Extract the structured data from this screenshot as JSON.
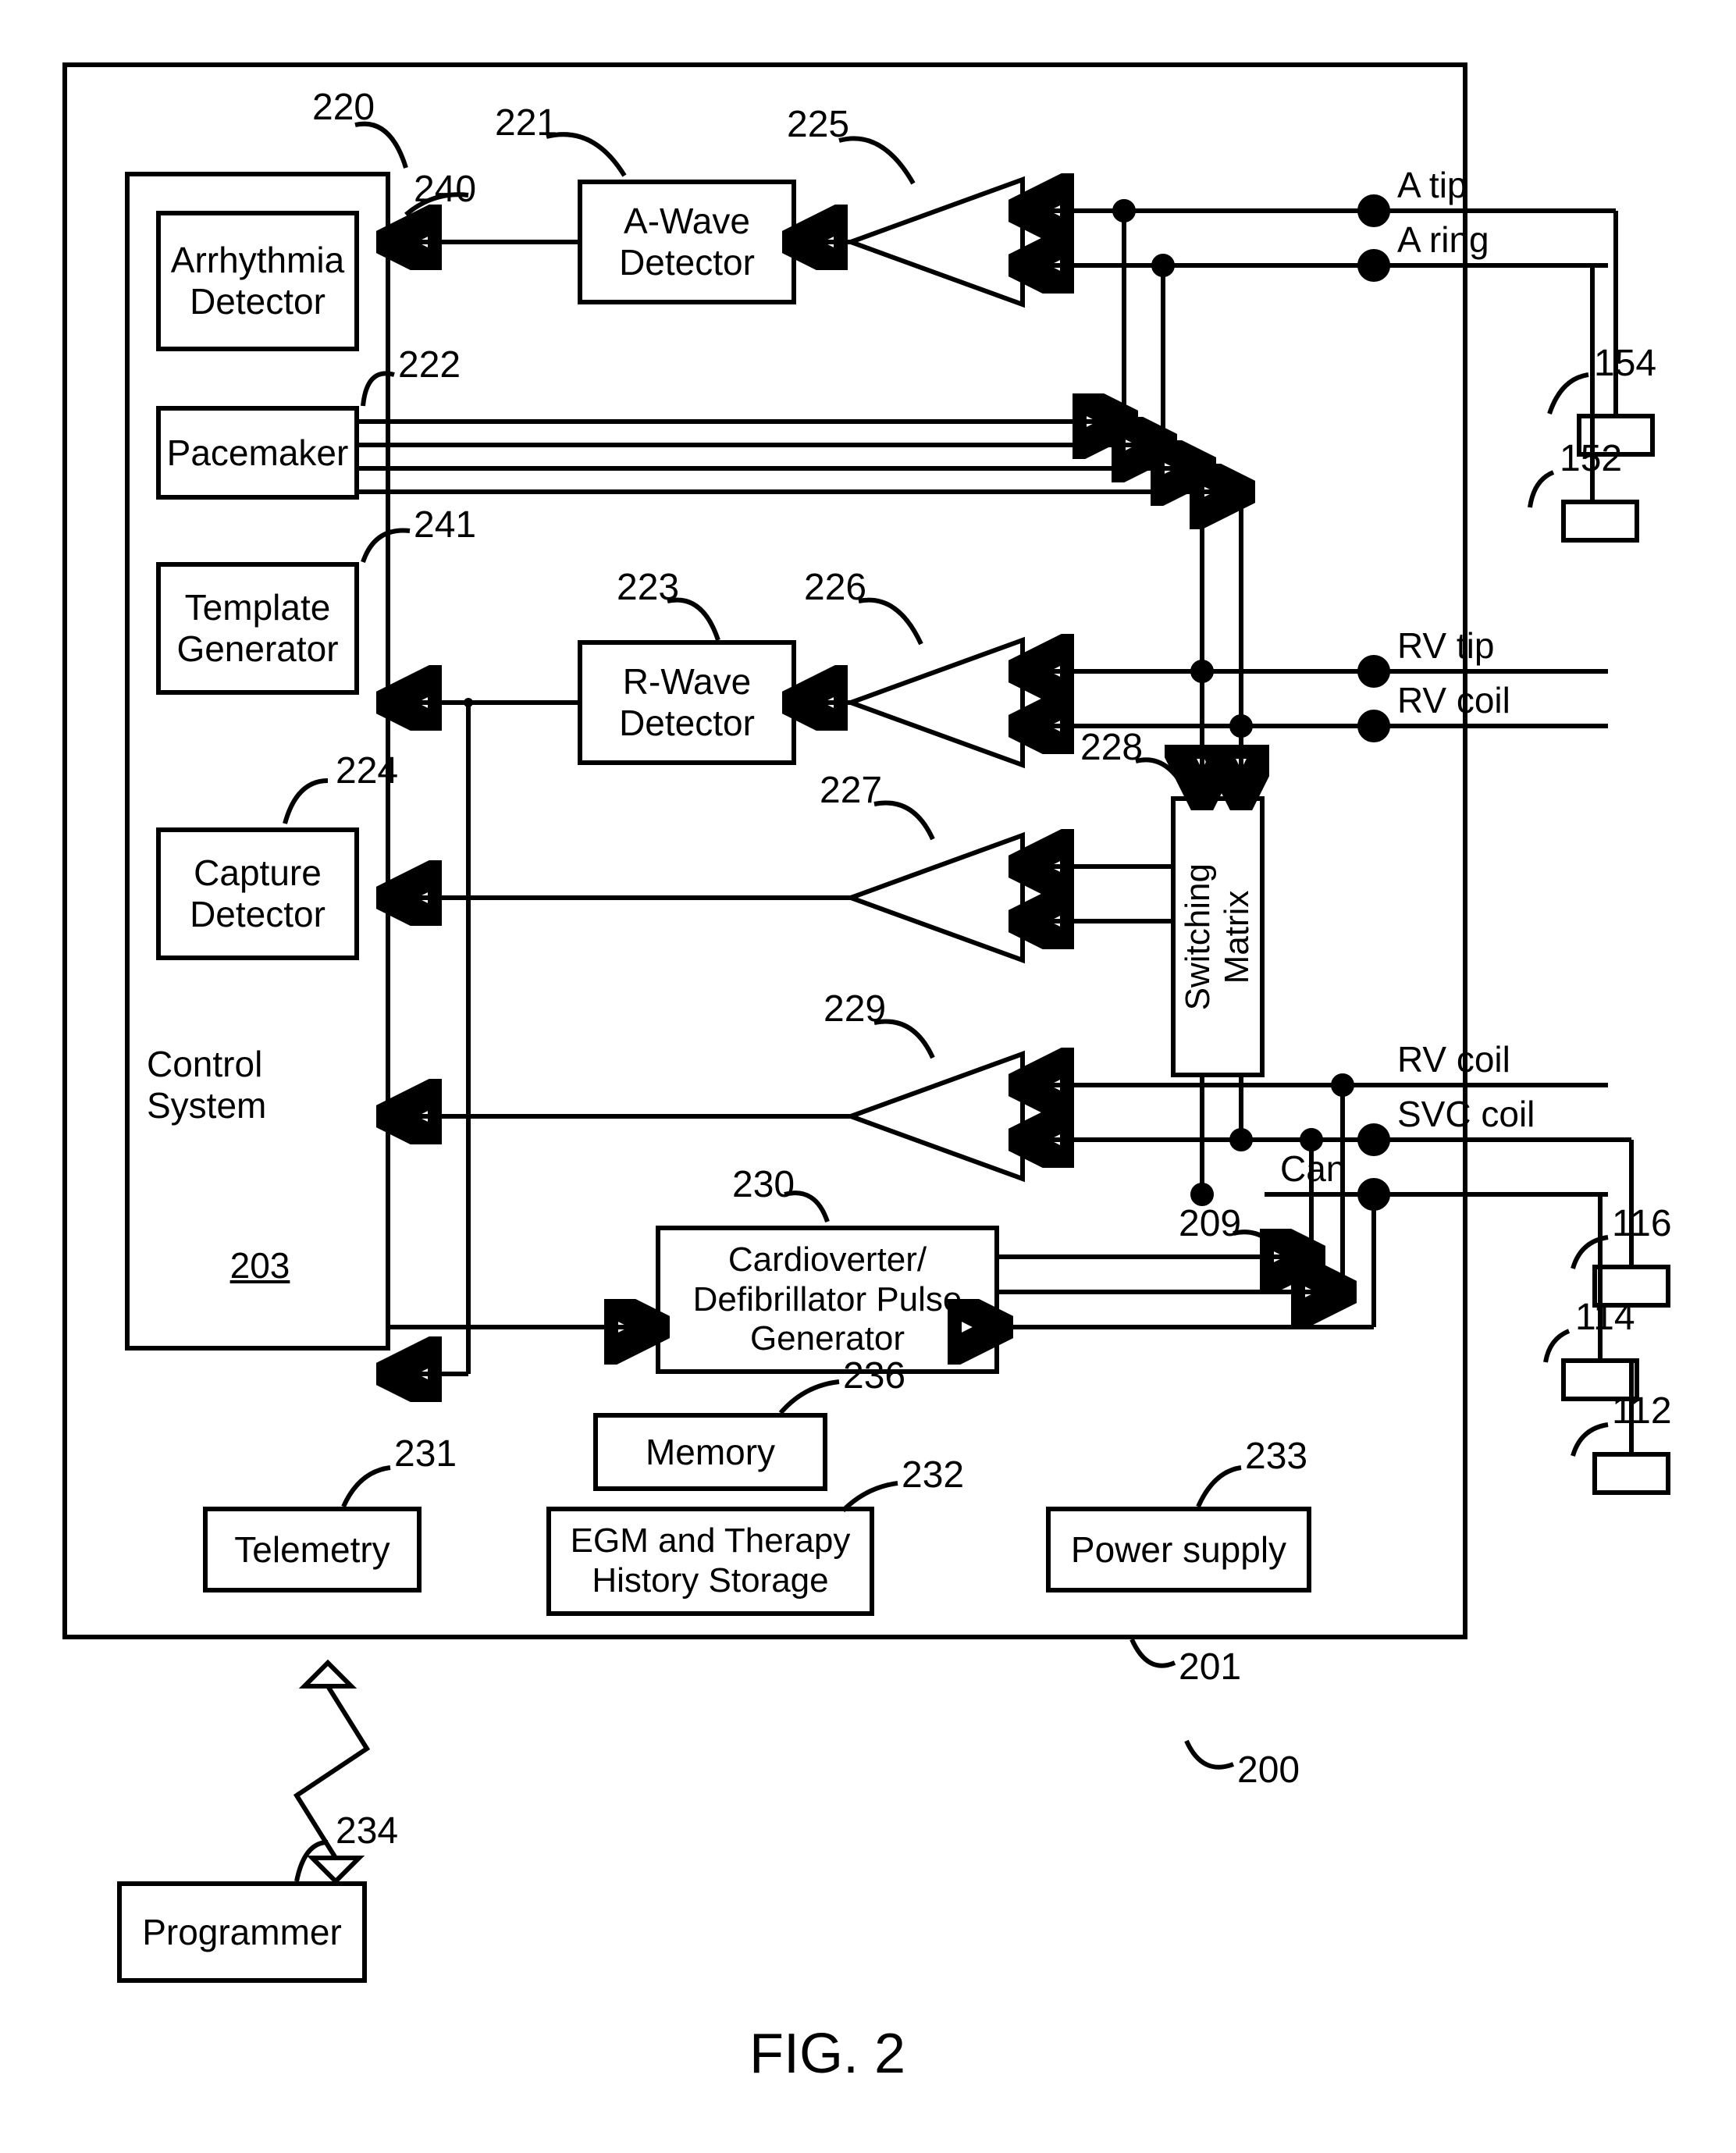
{
  "figure": "FIG. 2",
  "outer_ref": "201",
  "system_ref": "200",
  "control_system": {
    "label": "Control System",
    "ref_underlined": "203"
  },
  "blocks": {
    "arrhythmia": {
      "label": "Arrhythmia\nDetector",
      "ref": "220"
    },
    "awave": {
      "label": "A-Wave\nDetector",
      "ref": "221"
    },
    "amp_a": {
      "ref": "225"
    },
    "pacemaker": {
      "label": "Pacemaker",
      "ref": "222"
    },
    "template": {
      "label": "Template\nGenerator",
      "ref": "241"
    },
    "rwave": {
      "label": "R-Wave\nDetector",
      "ref": "223"
    },
    "amp_r": {
      "ref": "226"
    },
    "capture": {
      "label": "Capture\nDetector",
      "ref": "224"
    },
    "amp_c": {
      "ref": "227"
    },
    "switching": {
      "label": "Switching\nMatrix",
      "ref": "228"
    },
    "amp_s": {
      "ref": "229"
    },
    "cardio": {
      "label": "Cardioverter/\nDefibrillator Pulse\nGenerator",
      "ref": "230"
    },
    "telemetry": {
      "label": "Telemetry",
      "ref": "231"
    },
    "memory": {
      "label": "Memory",
      "ref": "236"
    },
    "egm": {
      "label": "EGM and Therapy\nHistory Storage",
      "ref": "232"
    },
    "power": {
      "label": "Power supply",
      "ref": "233"
    },
    "programmer": {
      "label": "Programmer",
      "ref": "234"
    },
    "ref240": "240",
    "ref209": "209"
  },
  "terminals": {
    "atip": "A tip",
    "aring": "A ring",
    "rvtip": "RV tip",
    "rvcoil_top": "RV coil",
    "rvcoil_bot": "RV coil",
    "svccoil": "SVC coil",
    "can": "Can"
  },
  "ext_refs": {
    "e154": "154",
    "e152": "152",
    "e116": "116",
    "e114": "114",
    "e112": "112"
  }
}
